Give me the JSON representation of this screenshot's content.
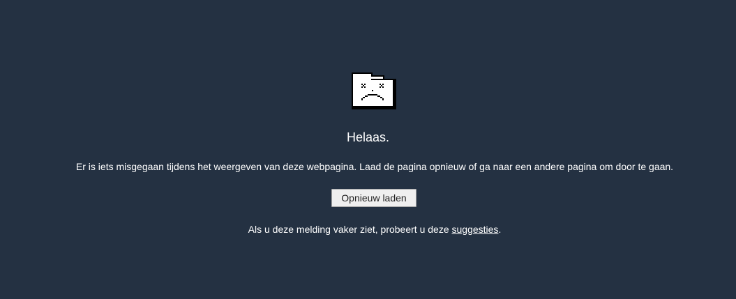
{
  "error": {
    "icon": "sad-folder-icon",
    "title": "Helaas.",
    "message": "Er is iets misgegaan tijdens het weergeven van deze webpagina. Laad de pagina opnieuw of ga naar een andere pagina om door te gaan.",
    "reload_label": "Opnieuw laden",
    "hint_prefix": "Als u deze melding vaker ziet, probeert u deze ",
    "hint_link": "suggesties",
    "hint_suffix": "."
  },
  "colors": {
    "background": "#243142",
    "text": "#ffffff",
    "button_background": "#efefef",
    "button_text": "#222222"
  }
}
